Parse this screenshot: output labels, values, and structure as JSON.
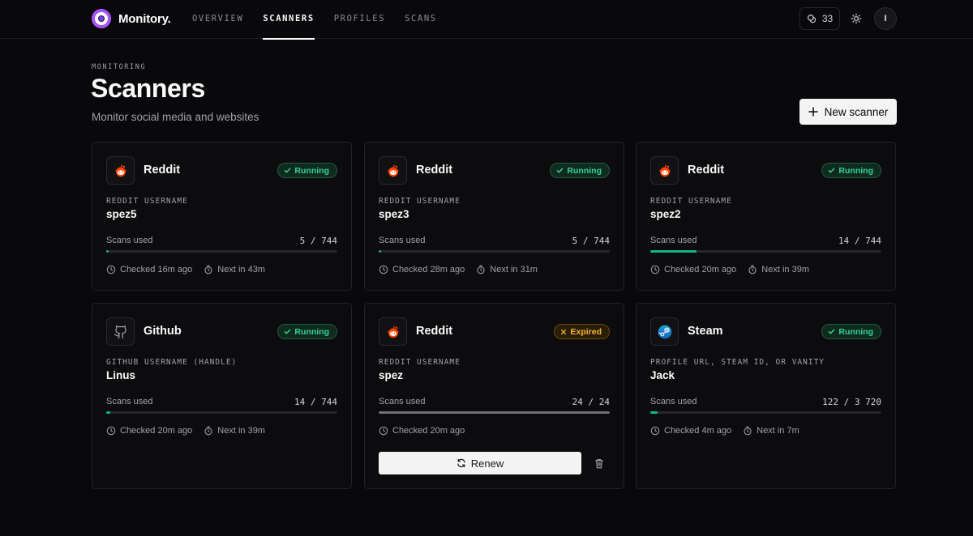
{
  "app": {
    "name": "Monitory."
  },
  "nav": [
    {
      "label": "OVERVIEW",
      "active": false
    },
    {
      "label": "SCANNERS",
      "active": true
    },
    {
      "label": "PROFILES",
      "active": false
    },
    {
      "label": "SCANS",
      "active": false
    }
  ],
  "header": {
    "credits": "33",
    "avatar_initial": "I"
  },
  "page": {
    "eyebrow": "MONITORING",
    "title": "Scanners",
    "subtitle": "Monitor social media and websites",
    "new_button": "New scanner"
  },
  "labels": {
    "scans_used": "Scans used",
    "renew": "Renew"
  },
  "colors": {
    "accent": "#a855f7",
    "running": "#34d399",
    "expired": "#f5b53b",
    "reddit": "#ff4500",
    "progress": "#10b981"
  },
  "scanners": [
    {
      "service": "Reddit",
      "icon": "reddit-icon",
      "status": "Running",
      "field_label": "REDDIT USERNAME",
      "value": "spez5",
      "scans": "5 / 744",
      "progress": 0.0067,
      "checked": "Checked 16m ago",
      "next": "Next in 43m"
    },
    {
      "service": "Reddit",
      "icon": "reddit-icon",
      "status": "Running",
      "field_label": "REDDIT USERNAME",
      "value": "spez3",
      "scans": "5 / 744",
      "progress": 0.0067,
      "checked": "Checked 28m ago",
      "next": "Next in 31m"
    },
    {
      "service": "Reddit",
      "icon": "reddit-icon",
      "status": "Running",
      "field_label": "REDDIT USERNAME",
      "value": "spez2",
      "scans": "14 / 744",
      "progress": 0.2,
      "checked": "Checked 20m ago",
      "next": "Next in 39m"
    },
    {
      "service": "Github",
      "icon": "github-icon",
      "status": "Running",
      "field_label": "GITHUB USERNAME (HANDLE)",
      "value": "Linus",
      "scans": "14 / 744",
      "progress": 0.019,
      "checked": "Checked 20m ago",
      "next": "Next in 39m"
    },
    {
      "service": "Reddit",
      "icon": "reddit-icon",
      "status": "Expired",
      "field_label": "REDDIT USERNAME",
      "value": "spez",
      "scans": "24 / 24",
      "progress": 1.0,
      "checked": "Checked 20m ago",
      "next": ""
    },
    {
      "service": "Steam",
      "icon": "steam-icon",
      "status": "Running",
      "field_label": "PROFILE URL, STEAM ID, OR VANITY",
      "value": "Jack",
      "scans": "122 / 3 720",
      "progress": 0.033,
      "checked": "Checked 4m ago",
      "next": "Next in 7m"
    }
  ]
}
